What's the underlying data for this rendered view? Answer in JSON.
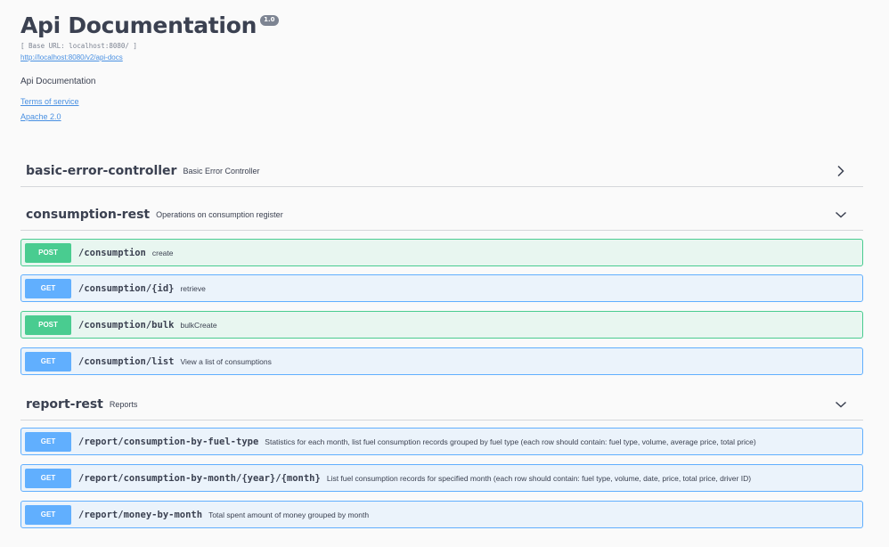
{
  "info": {
    "title": "Api Documentation",
    "version": "1.0",
    "base_url": "[ Base URL: localhost:8080/ ]",
    "docs_link": "http://localhost:8080/v2/api-docs",
    "description": "Api Documentation",
    "terms_link": "Terms of service",
    "license_link": "Apache 2.0"
  },
  "tags": [
    {
      "name": "basic-error-controller",
      "description": "Basic Error Controller",
      "expanded": false,
      "operations": []
    },
    {
      "name": "consumption-rest",
      "description": "Operations on consumption register",
      "expanded": true,
      "operations": [
        {
          "method": "POST",
          "path": "/consumption",
          "summary": "create"
        },
        {
          "method": "GET",
          "path": "/consumption/{id}",
          "summary": "retrieve"
        },
        {
          "method": "POST",
          "path": "/consumption/bulk",
          "summary": "bulkCreate"
        },
        {
          "method": "GET",
          "path": "/consumption/list",
          "summary": "View a list of consumptions"
        }
      ]
    },
    {
      "name": "report-rest",
      "description": "Reports",
      "expanded": true,
      "operations": [
        {
          "method": "GET",
          "path": "/report/consumption-by-fuel-type",
          "summary": "Statistics for each month, list fuel consumption records grouped by fuel type (each row should contain: fuel type, volume, average price, total price)"
        },
        {
          "method": "GET",
          "path": "/report/consumption-by-month/{year}/{month}",
          "summary": "List fuel consumption records for specified month (each row should contain: fuel type, volume, date, price, total price, driver ID)"
        },
        {
          "method": "GET",
          "path": "/report/money-by-month",
          "summary": "Total spent amount of money grouped by month"
        }
      ]
    }
  ],
  "colors": {
    "post": "#49cc90",
    "get": "#61affe",
    "text": "#3b4151",
    "link": "#4990e2"
  }
}
